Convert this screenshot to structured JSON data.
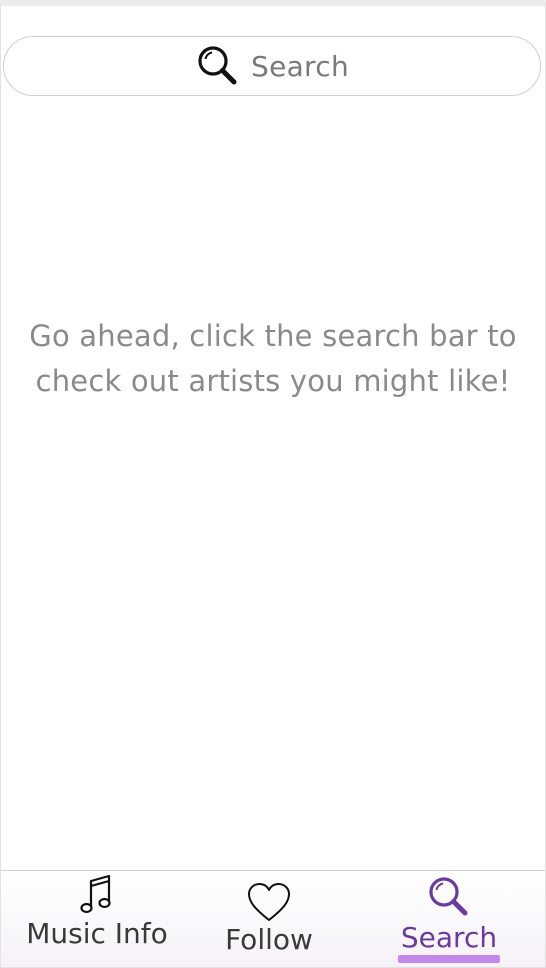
{
  "search": {
    "placeholder": "Search",
    "icon": "search-icon"
  },
  "empty_state": {
    "line1": "Go ahead, click the search bar to",
    "line2": "check out artists you might like!"
  },
  "tabbar": {
    "active_tab": "Search",
    "active_color": "#6a3b9a",
    "underline_color": "#c488ea",
    "tabs": [
      {
        "label": "Music Info",
        "icon": "music-note-icon"
      },
      {
        "label": "Follow",
        "icon": "heart-icon"
      },
      {
        "label": "Search",
        "icon": "search-icon"
      }
    ]
  }
}
